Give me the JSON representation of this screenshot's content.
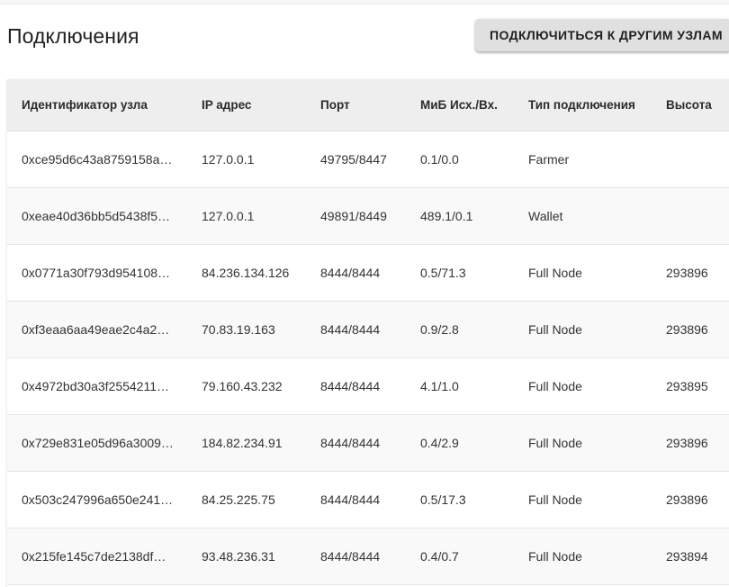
{
  "page": {
    "title": "Подключения",
    "connect_button_label": "ПОДКЛЮЧИТЬСЯ К ДРУГИМ УЗЛАМ"
  },
  "table": {
    "headers": {
      "node_id": "Идентификатор узла",
      "ip": "IP адрес",
      "port": "Порт",
      "mib": "МиБ Исх./Вх.",
      "type": "Тип подключения",
      "height": "Высота"
    },
    "rows": [
      {
        "node_id": "0xce95d6c43a8759158a…",
        "ip": "127.0.0.1",
        "port": "49795/8447",
        "mib": "0.1/0.0",
        "type": "Farmer",
        "height": ""
      },
      {
        "node_id": "0xeae40d36bb5d5438f5…",
        "ip": "127.0.0.1",
        "port": "49891/8449",
        "mib": "489.1/0.1",
        "type": "Wallet",
        "height": ""
      },
      {
        "node_id": "0x0771a30f793d954108…",
        "ip": "84.236.134.126",
        "port": "8444/8444",
        "mib": "0.5/71.3",
        "type": "Full Node",
        "height": "293896"
      },
      {
        "node_id": "0xf3eaa6aa49eae2c4a2…",
        "ip": "70.83.19.163",
        "port": "8444/8444",
        "mib": "0.9/2.8",
        "type": "Full Node",
        "height": "293896"
      },
      {
        "node_id": "0x4972bd30a3f2554211…",
        "ip": "79.160.43.232",
        "port": "8444/8444",
        "mib": "4.1/1.0",
        "type": "Full Node",
        "height": "293895"
      },
      {
        "node_id": "0x729e831e05d96a3009…",
        "ip": "184.82.234.91",
        "port": "8444/8444",
        "mib": "0.4/2.9",
        "type": "Full Node",
        "height": "293896"
      },
      {
        "node_id": "0x503c247996a650e241…",
        "ip": "84.25.225.75",
        "port": "8444/8444",
        "mib": "0.5/17.3",
        "type": "Full Node",
        "height": "293896"
      },
      {
        "node_id": "0x215fe145c7de2138df…",
        "ip": "93.48.236.31",
        "port": "8444/8444",
        "mib": "0.4/0.7",
        "type": "Full Node",
        "height": "293894"
      }
    ]
  }
}
